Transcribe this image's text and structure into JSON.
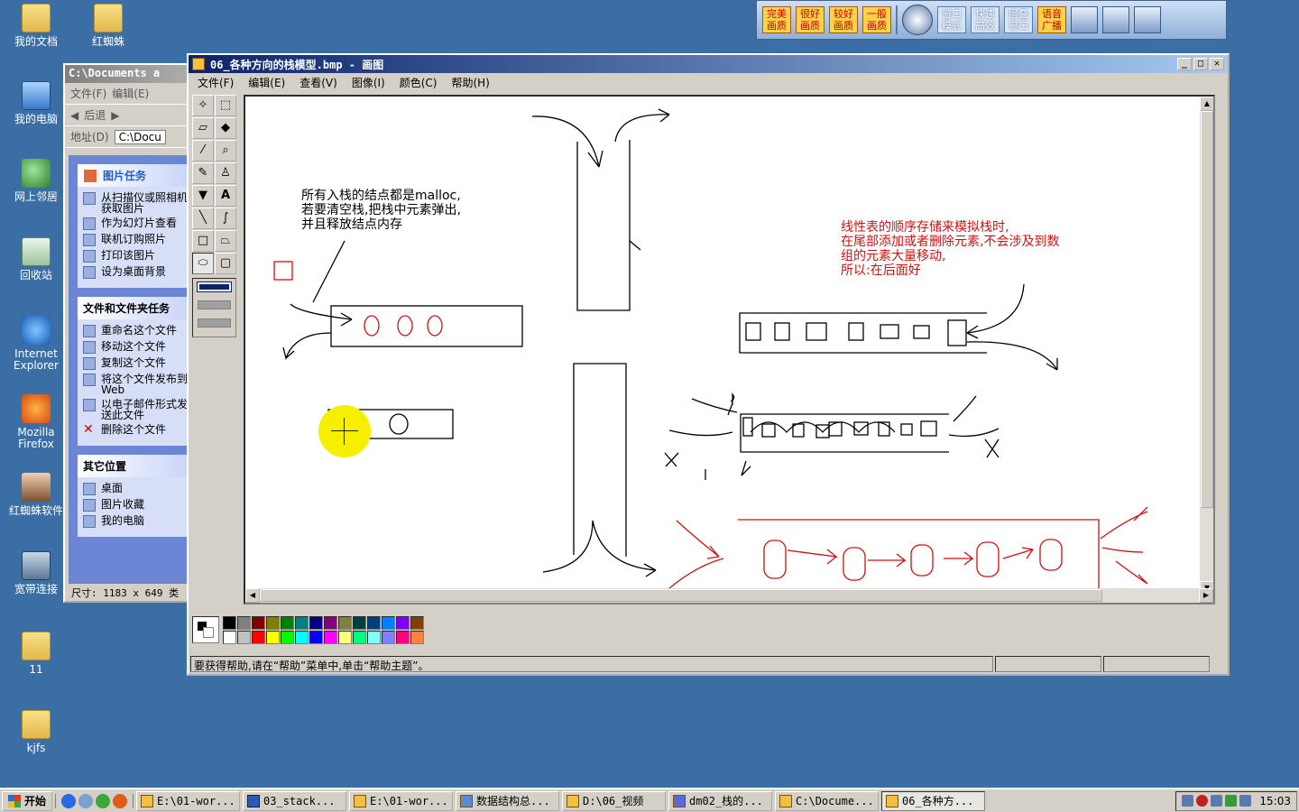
{
  "desktop": {
    "icons": [
      {
        "label": "我的文档",
        "icon": "folder-icon"
      },
      {
        "label": "红蜘蛛",
        "icon": "folder-icon"
      },
      {
        "label": "我的电脑",
        "icon": "computer-icon"
      },
      {
        "label": "网上邻居",
        "icon": "network-icon"
      },
      {
        "label": "回收站",
        "icon": "recycle-bin-icon"
      },
      {
        "label": "Internet Explorer",
        "icon": "ie-icon"
      },
      {
        "label": "Mozilla Firefox",
        "icon": "firefox-icon"
      },
      {
        "label": "红蜘蛛软件",
        "icon": "person-icon"
      },
      {
        "label": "宽带连接",
        "icon": "broadband-icon"
      },
      {
        "label": "11",
        "icon": "folder-icon"
      },
      {
        "label": "kjfs",
        "icon": "folder-icon"
      }
    ]
  },
  "topbar": {
    "buttons": [
      "完美画质",
      "很好画质",
      "较好画质",
      "一般画质",
      "窗口模式",
      "快速高效",
      "层叠窗口",
      "语音广播"
    ]
  },
  "explorer": {
    "title": "C:\\Documents a",
    "menu": [
      "文件(F)",
      "编辑(E)"
    ],
    "back": "后退",
    "address_label": "地址(D)",
    "address_value": "C:\\Docu",
    "picture_tasks": {
      "heading": "图片任务",
      "items": [
        "从扫描仪或照相机获取图片",
        "作为幻灯片查看",
        "联机订购照片",
        "打印该图片",
        "设为桌面背景"
      ]
    },
    "file_tasks": {
      "heading": "文件和文件夹任务",
      "items": [
        "重命名这个文件",
        "移动这个文件",
        "复制这个文件",
        "将这个文件发布到 Web",
        "以电子邮件形式发送此文件",
        "删除这个文件"
      ]
    },
    "other_places": {
      "heading": "其它位置",
      "items": [
        "桌面",
        "图片收藏",
        "我的电脑"
      ]
    },
    "status": "尺寸: 1183 x 649 类"
  },
  "paint": {
    "title": "06_各种方向的栈模型.bmp - 画图",
    "menu": [
      "文件(F)",
      "编辑(E)",
      "查看(V)",
      "图像(I)",
      "颜色(C)",
      "帮助(H)"
    ],
    "canvas": {
      "note_black": "所有入栈的结点都是malloc,\n若要清空栈,把栈中元素弹出,\n并且释放结点内存",
      "note_red": "线性表的顺序存储来模拟栈时,\n在尾部添加或者删除元素,不会涉及到数\n组的元素大量移动,\n所以:在后面好"
    },
    "palette": [
      "#000000",
      "#ffffff",
      "#808080",
      "#c0c0c0",
      "#800000",
      "#ff0000",
      "#808000",
      "#ffff00",
      "#008000",
      "#00ff00",
      "#008080",
      "#00ffff",
      "#000080",
      "#0000ff",
      "#800080",
      "#ff00ff",
      "#808040",
      "#ffff80",
      "#004040",
      "#00ff80",
      "#004080",
      "#80ffff",
      "#0080ff",
      "#8080ff",
      "#8000ff",
      "#ff0080",
      "#804000",
      "#ff8040"
    ],
    "status": "要获得帮助,请在“帮助”菜单中,单击“帮助主题”。"
  },
  "taskbar": {
    "start": "开始",
    "tasks": [
      "E:\\01-wor...",
      "03_stack...",
      "E:\\01-wor...",
      "数据结构总...",
      "D:\\06_视频",
      "dm02_栈的...",
      "C:\\Docume...",
      "06_各种方..."
    ],
    "active_task_index": 7,
    "clock": "15:03"
  }
}
